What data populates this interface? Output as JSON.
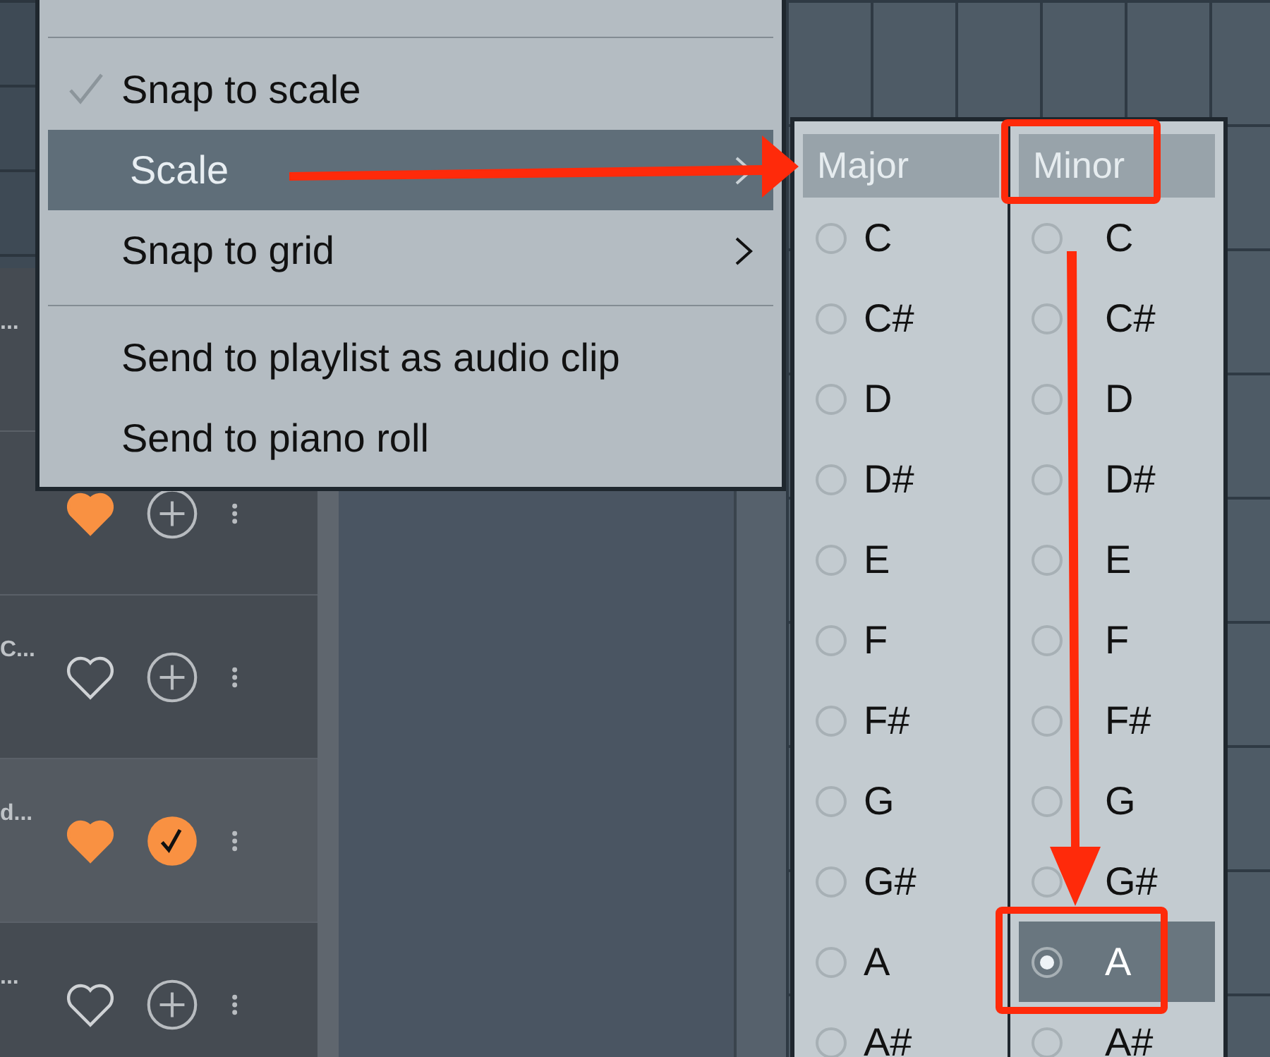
{
  "rows": [
    {
      "title": "...",
      "selected": false
    },
    {
      "favorite": true,
      "added": false,
      "selected": false
    },
    {
      "title": "C...",
      "favorite": false,
      "added": false,
      "selected": false
    },
    {
      "title": "d...",
      "favorite": true,
      "added": true,
      "selected": true
    },
    {
      "title": "...",
      "favorite": false,
      "added": false,
      "selected": false
    }
  ],
  "context_menu": {
    "items": [
      {
        "kind": "separator"
      },
      {
        "kind": "item",
        "label": "Snap to scale",
        "checked": true,
        "submenu": false,
        "selected": false
      },
      {
        "kind": "item",
        "label": "Scale",
        "checked": false,
        "submenu": true,
        "selected": true
      },
      {
        "kind": "item",
        "label": "Snap to grid",
        "checked": false,
        "submenu": true,
        "selected": false
      },
      {
        "kind": "separator"
      },
      {
        "kind": "item",
        "label": "Send to playlist as audio clip",
        "checked": false,
        "submenu": false,
        "selected": false
      },
      {
        "kind": "item",
        "label": "Send to piano roll",
        "checked": false,
        "submenu": false,
        "selected": false
      }
    ]
  },
  "scale_menu": {
    "columns": [
      {
        "header": "Major",
        "notes": [
          {
            "label": "C",
            "selected": false
          },
          {
            "label": "C#",
            "selected": false
          },
          {
            "label": "D",
            "selected": false
          },
          {
            "label": "D#",
            "selected": false
          },
          {
            "label": "E",
            "selected": false
          },
          {
            "label": "F",
            "selected": false
          },
          {
            "label": "F#",
            "selected": false
          },
          {
            "label": "G",
            "selected": false
          },
          {
            "label": "G#",
            "selected": false
          },
          {
            "label": "A",
            "selected": false
          },
          {
            "label": "A#",
            "selected": false
          }
        ]
      },
      {
        "header": "Minor",
        "notes": [
          {
            "label": "C",
            "selected": false
          },
          {
            "label": "C#",
            "selected": false
          },
          {
            "label": "D",
            "selected": false
          },
          {
            "label": "D#",
            "selected": false
          },
          {
            "label": "E",
            "selected": false
          },
          {
            "label": "F",
            "selected": false
          },
          {
            "label": "F#",
            "selected": false
          },
          {
            "label": "G",
            "selected": false
          },
          {
            "label": "G#",
            "selected": false
          },
          {
            "label": "A",
            "selected": true
          },
          {
            "label": "A#",
            "selected": false
          }
        ]
      }
    ]
  }
}
